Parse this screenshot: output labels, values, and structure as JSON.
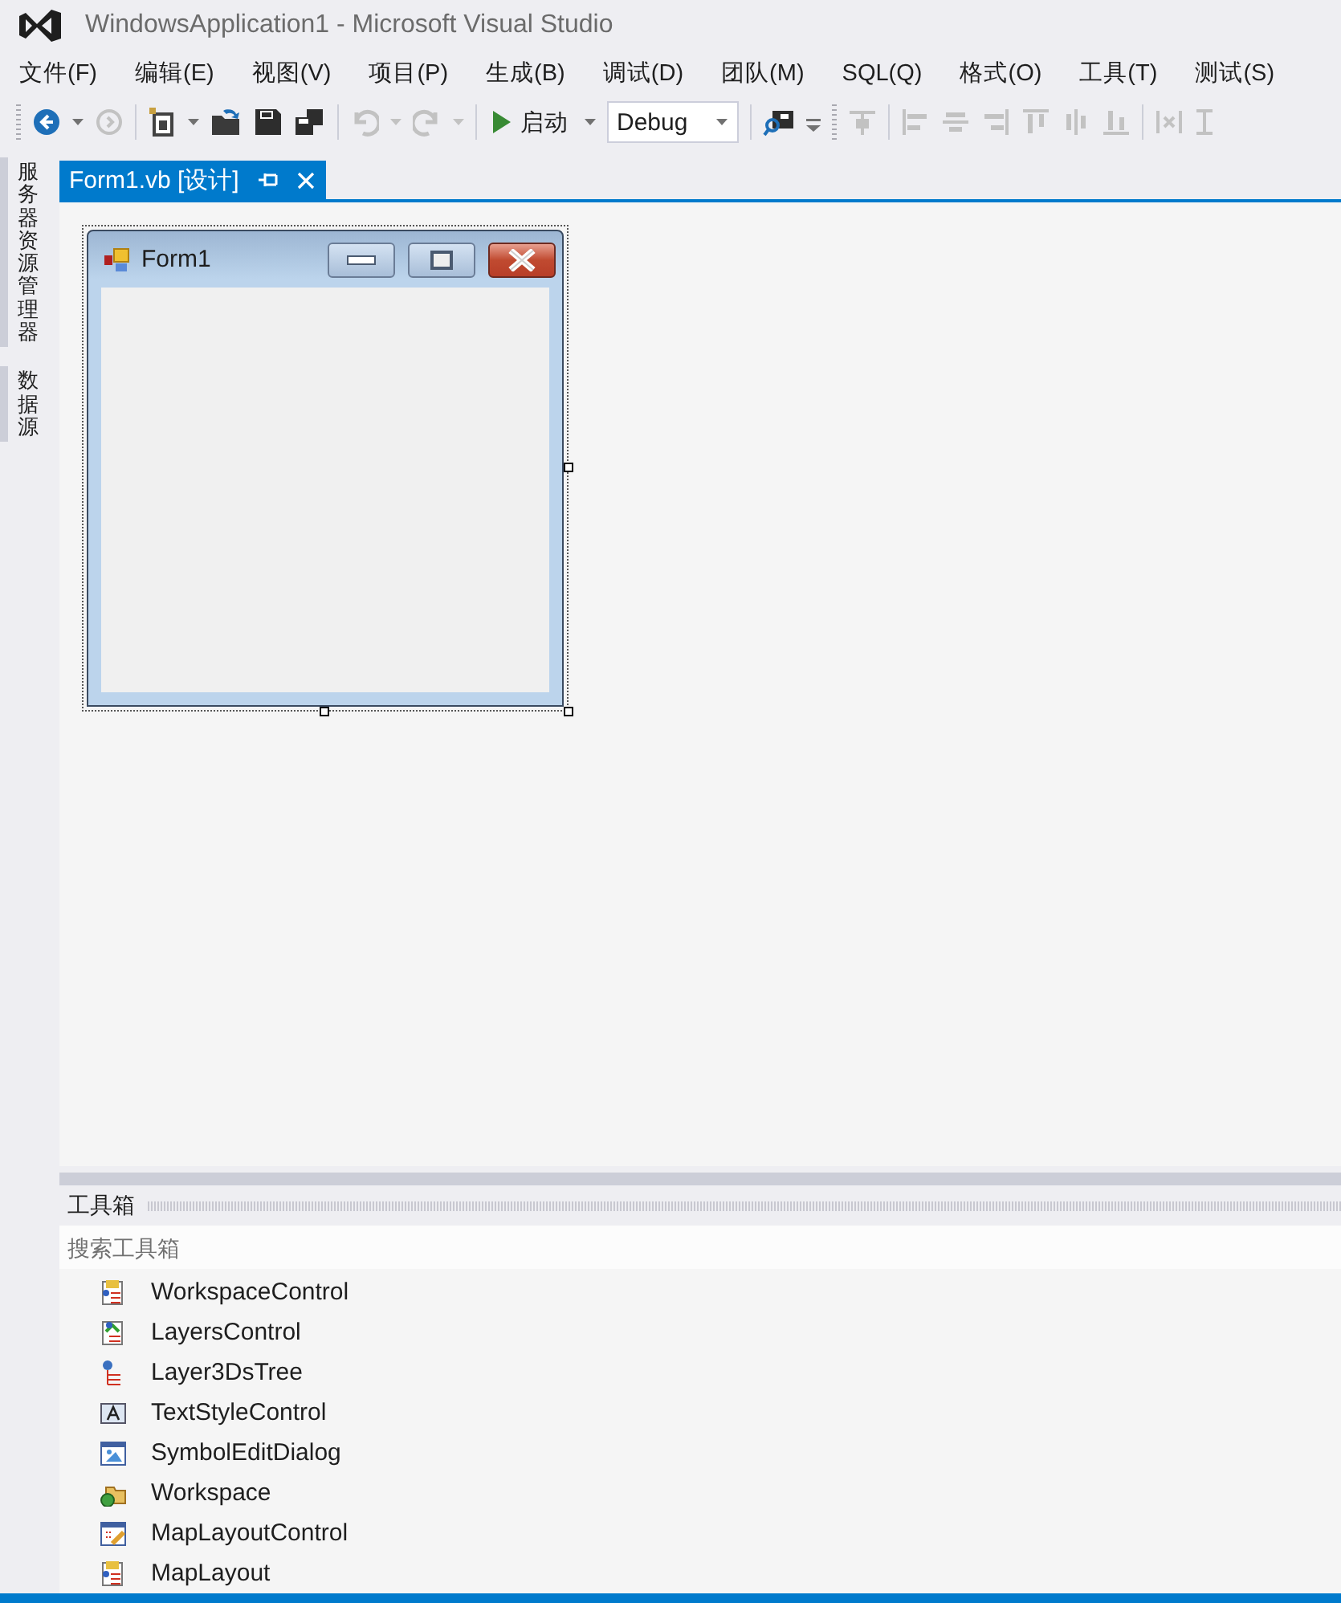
{
  "window": {
    "title": "WindowsApplication1 - Microsoft Visual Studio"
  },
  "menu": [
    {
      "label": "文件(F)"
    },
    {
      "label": "编辑(E)"
    },
    {
      "label": "视图(V)"
    },
    {
      "label": "项目(P)"
    },
    {
      "label": "生成(B)"
    },
    {
      "label": "调试(D)"
    },
    {
      "label": "团队(M)"
    },
    {
      "label": "SQL(Q)"
    },
    {
      "label": "格式(O)"
    },
    {
      "label": "工具(T)"
    },
    {
      "label": "测试(S)"
    }
  ],
  "toolbar": {
    "start_label": "启动",
    "configuration": "Debug"
  },
  "side_tabs": [
    {
      "label": "服务器资源管理器"
    },
    {
      "label": "数据源"
    }
  ],
  "document_tabs": [
    {
      "label": "Form1.vb [设计]",
      "selected": true
    }
  ],
  "designer": {
    "form": {
      "title": "Form1"
    }
  },
  "toolbox": {
    "title": "工具箱",
    "search": {
      "placeholder": "搜索工具箱"
    },
    "items": [
      {
        "label": "WorkspaceControl"
      },
      {
        "label": "LayersControl"
      },
      {
        "label": "Layer3DsTree"
      },
      {
        "label": "TextStyleControl"
      },
      {
        "label": "SymbolEditDialog"
      },
      {
        "label": "Workspace"
      },
      {
        "label": "MapLayoutControl"
      },
      {
        "label": "MapLayout"
      }
    ]
  }
}
